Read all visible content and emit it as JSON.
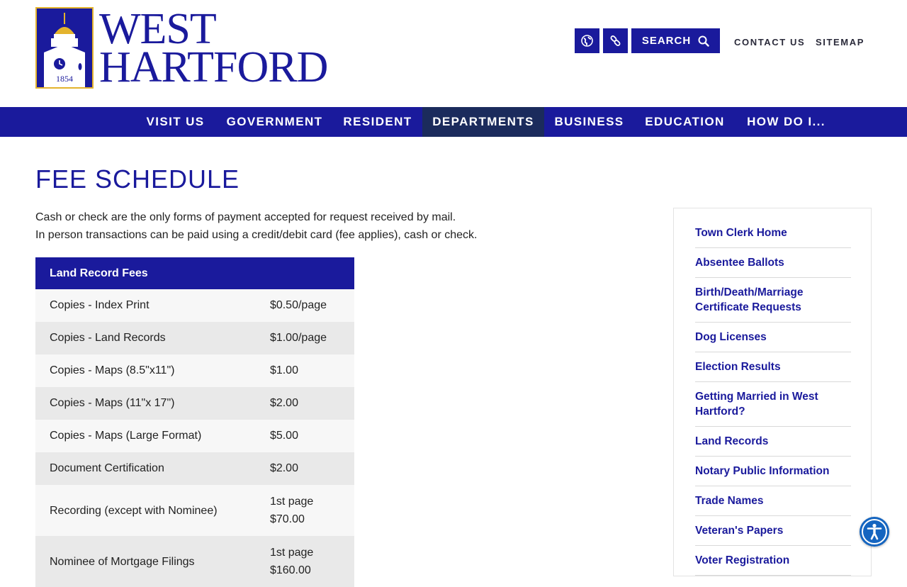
{
  "logo": {
    "line1": "WEST",
    "line2": "HARTFORD",
    "badge_year": "1854"
  },
  "utility": {
    "translate_icon": "globe-icon",
    "links_icon": "link-icon",
    "search_label": "SEARCH",
    "search_icon": "search-icon",
    "contact_label": "CONTACT US",
    "sitemap_label": "SITEMAP"
  },
  "nav": {
    "items": [
      {
        "label": "VISIT US"
      },
      {
        "label": "GOVERNMENT"
      },
      {
        "label": "RESIDENT"
      },
      {
        "label": "DEPARTMENTS",
        "active": true
      },
      {
        "label": "BUSINESS"
      },
      {
        "label": "EDUCATION"
      },
      {
        "label": "HOW DO I..."
      }
    ]
  },
  "main": {
    "title": "FEE SCHEDULE",
    "intro_line1": "Cash or check are the only forms of payment accepted for request received by mail.",
    "intro_line2": "In person transactions can be paid using a credit/debit card (fee applies), cash or check.",
    "table": {
      "header": "Land Record Fees",
      "rows": [
        {
          "item": "Copies - Index Print",
          "fee": "$0.50/page"
        },
        {
          "item": "Copies - Land Records",
          "fee": "$1.00/page"
        },
        {
          "item": "Copies - Maps (8.5\"x11\")",
          "fee": "$1.00"
        },
        {
          "item": "Copies - Maps (11\"x 17\")",
          "fee": "$2.00"
        },
        {
          "item": "Copies - Maps (Large Format)",
          "fee": "$5.00"
        },
        {
          "item": "Document Certification",
          "fee": "$2.00"
        },
        {
          "item": "Recording (except with Nominee)",
          "fee_line1": "1st page",
          "fee_line2": "$70.00"
        },
        {
          "item": "Nominee of Mortgage Filings",
          "fee_line1": "1st page",
          "fee_line2": "$160.00"
        }
      ]
    }
  },
  "sidebar": {
    "items": [
      {
        "label": "Town Clerk Home"
      },
      {
        "label": "Absentee Ballots"
      },
      {
        "label": "Birth/Death/Marriage Certificate Requests"
      },
      {
        "label": "Dog Licenses"
      },
      {
        "label": "Election Results"
      },
      {
        "label": "Getting Married in West Hartford?"
      },
      {
        "label": "Land Records"
      },
      {
        "label": "Notary Public Information"
      },
      {
        "label": "Trade Names"
      },
      {
        "label": "Veteran's Papers"
      },
      {
        "label": "Voter Registration"
      }
    ]
  },
  "accessibility": {
    "icon": "accessibility-icon"
  },
  "colors": {
    "brand": "#1a1a9c",
    "nav_active": "#1b2b5c",
    "gold": "#e3b32d"
  }
}
